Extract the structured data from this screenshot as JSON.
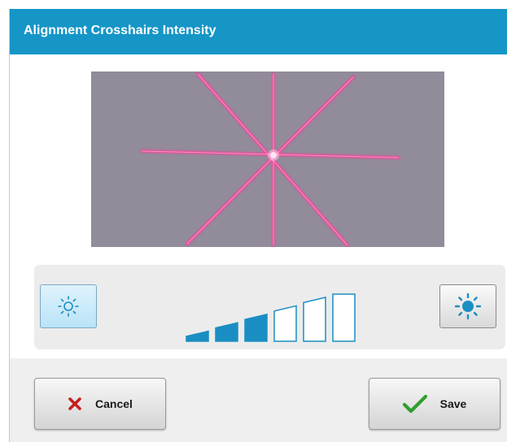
{
  "dialog": {
    "title": "Alignment Crosshairs Intensity"
  },
  "preview": {
    "description": "laser crosshairs preview",
    "background_color": "#8e8997",
    "laser_color": "#f2479a"
  },
  "intensity": {
    "dim_icon": "sun-dim-icon",
    "bright_icon": "sun-bright-icon",
    "level": 3,
    "max_level": 6,
    "fill_color": "#1a8ec2"
  },
  "footer": {
    "cancel_label": "Cancel",
    "cancel_icon": "x-icon",
    "cancel_icon_color": "#c62020",
    "save_label": "Save",
    "save_icon": "checkmark-icon",
    "save_icon_color": "#2f9e2f"
  }
}
